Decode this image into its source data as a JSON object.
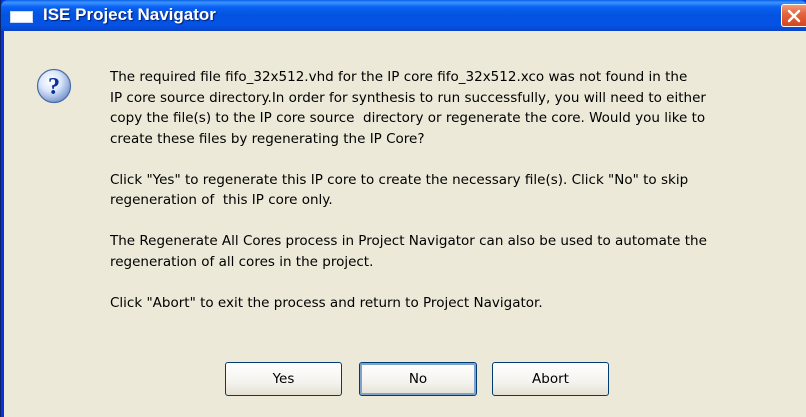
{
  "window": {
    "title": "ISE Project Navigator",
    "close_label": "close"
  },
  "dialog": {
    "icon": "question-icon",
    "paragraphs": [
      "The required file fifo_32x512.vhd for the IP core fifo_32x512.xco was not found in the\nIP core source directory.In order for synthesis to run successfully, you will need to either\ncopy the file(s) to the IP core source  directory or regenerate the core. Would you like to\ncreate these files by regenerating the IP Core?",
      "Click \"Yes\" to regenerate this IP core to create the necessary file(s). Click \"No\" to skip\nregeneration of  this IP core only.",
      "The Regenerate All Cores process in Project Navigator can also be used to automate the\nregeneration of all cores in the project.",
      "Click \"Abort\" to exit the process and return to Project Navigator."
    ]
  },
  "buttons": {
    "yes": "Yes",
    "no": "No",
    "abort": "Abort"
  },
  "colors": {
    "titlebar": "#0553e5",
    "client": "#ece9d8",
    "close": "#e5663e"
  }
}
